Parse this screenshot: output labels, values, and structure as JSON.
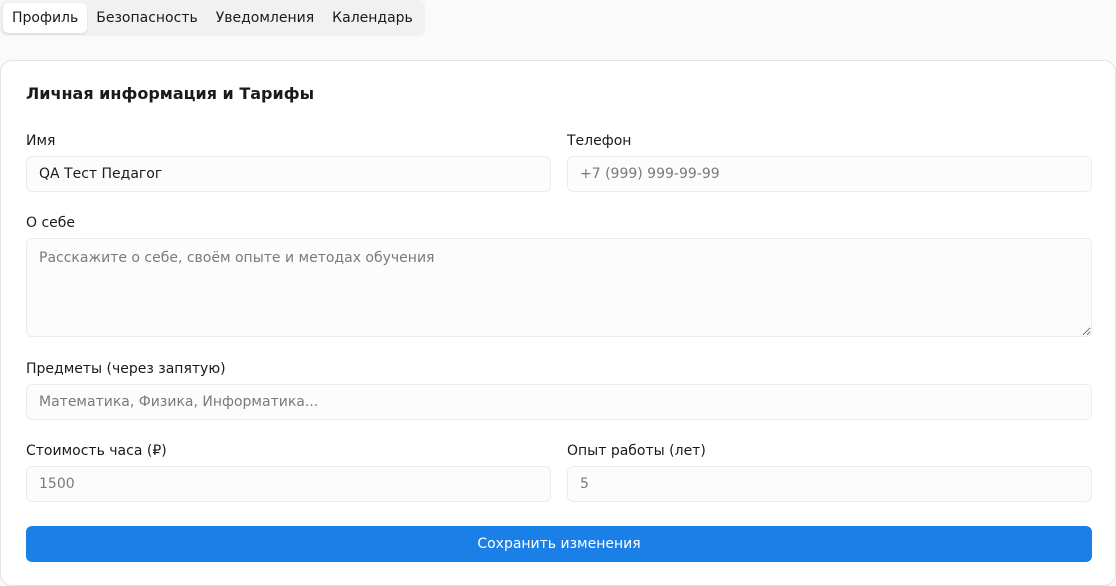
{
  "tabs": [
    {
      "label": "Профиль",
      "active": true
    },
    {
      "label": "Безопасность",
      "active": false
    },
    {
      "label": "Уведомления",
      "active": false
    },
    {
      "label": "Календарь",
      "active": false
    }
  ],
  "card": {
    "title": "Личная информация и Тарифы"
  },
  "form": {
    "name": {
      "label": "Имя",
      "value": "QA Тест Педагог",
      "placeholder": ""
    },
    "phone": {
      "label": "Телефон",
      "value": "",
      "placeholder": "+7 (999) 999-99-99"
    },
    "about": {
      "label": "О себе",
      "value": "",
      "placeholder": "Расскажите о себе, своём опыте и методах обучения"
    },
    "subjects": {
      "label": "Предметы (через запятую)",
      "value": "",
      "placeholder": "Математика, Физика, Информатика..."
    },
    "rate": {
      "label": "Стоимость часа (₽)",
      "value": "",
      "placeholder": "1500"
    },
    "experience": {
      "label": "Опыт работы (лет)",
      "value": "",
      "placeholder": "5"
    }
  },
  "actions": {
    "save_label": "Сохранить изменения"
  },
  "colors": {
    "primary": "#1a80e8"
  }
}
